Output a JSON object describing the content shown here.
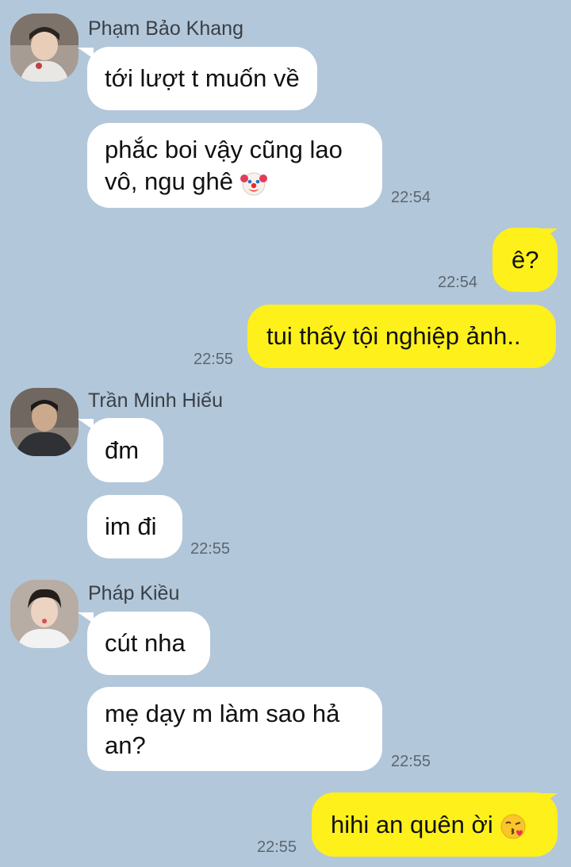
{
  "messages": {
    "g1": {
      "sender": "Phạm Bảo Khang",
      "m1": "tới lượt t muốn về",
      "m2_line1": "phắc boi vậy cũng lao",
      "m2_line2": "vô, ngu ghê",
      "m2_emoji": "clown-face",
      "time": "22:54"
    },
    "me1": {
      "text": "ê?",
      "time": "22:54"
    },
    "me2": {
      "text": "tui thấy tội nghiệp ảnh..",
      "time": "22:55"
    },
    "g2": {
      "sender": "Trần Minh Hiếu",
      "m1": "đm",
      "m2": "im đi",
      "time": "22:55"
    },
    "g3": {
      "sender": "Pháp Kiều",
      "m1": "cút nha",
      "m2_line1": "mẹ dạy m làm sao hả",
      "m2_line2": "an?",
      "time": "22:55"
    },
    "me3": {
      "text": "hihi an quên ời",
      "emoji": "kissing-face",
      "time": "22:55"
    }
  },
  "colors": {
    "background": "#b2c7da",
    "incoming_bubble": "#ffffff",
    "outgoing_bubble": "#fef01b",
    "timestamp": "#5c6670"
  }
}
